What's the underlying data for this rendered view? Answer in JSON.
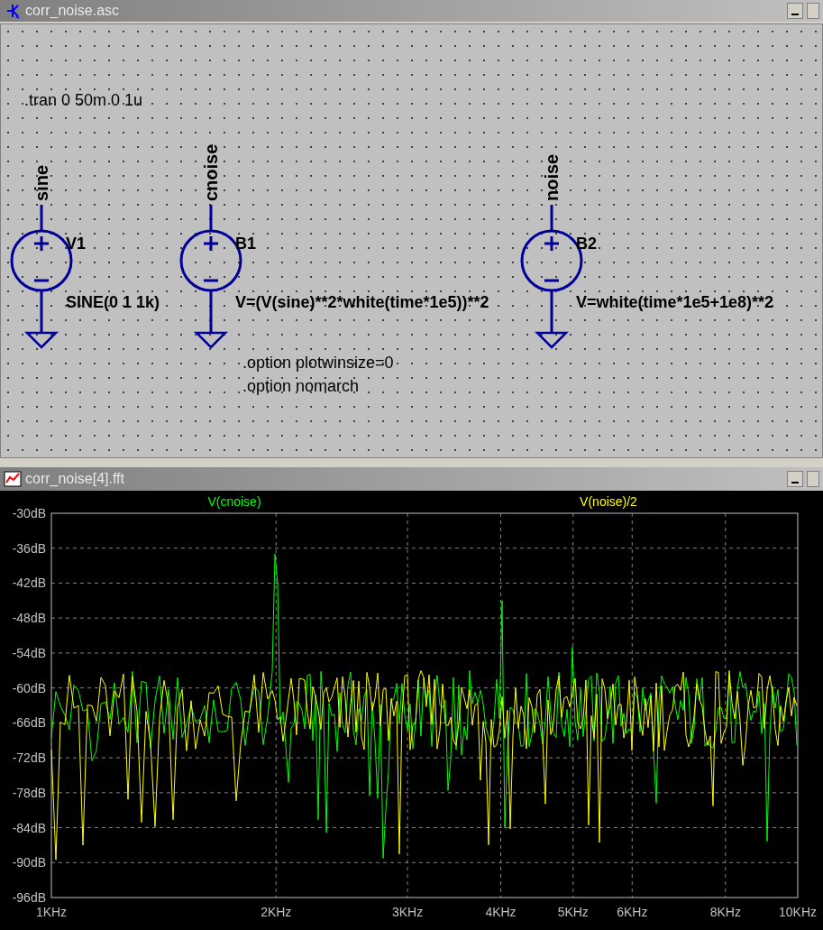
{
  "schematic": {
    "title": "corr_noise.asc",
    "directives": [
      ".tran 0 50m 0 1u",
      ".option plotwinsize=0",
      ".option nomarch"
    ],
    "components": [
      {
        "name": "V1",
        "value": "SINE(0 1 1k)",
        "net": "sine"
      },
      {
        "name": "B1",
        "value": "V=(V(sine)**2*white(time*1e5))**2",
        "net": "cnoise"
      },
      {
        "name": "B2",
        "value": "V=white(time*1e5+1e8)**2",
        "net": "noise"
      }
    ]
  },
  "plot": {
    "title": "corr_noise[4].fft",
    "traces": [
      {
        "name": "V(cnoise)",
        "color": "#00ff00"
      },
      {
        "name": "V(noise)/2",
        "color": "#ffff00"
      }
    ],
    "y_axis_labels": [
      "-30dB",
      "-36dB",
      "-42dB",
      "-48dB",
      "-54dB",
      "-60dB",
      "-66dB",
      "-72dB",
      "-78dB",
      "-84dB",
      "-90dB",
      "-96dB"
    ],
    "x_axis_labels": [
      "1KHz",
      "2KHz",
      "3KHz",
      "4KHz",
      "5KHz",
      "6KHz",
      "8KHz",
      "10KHz"
    ]
  }
}
